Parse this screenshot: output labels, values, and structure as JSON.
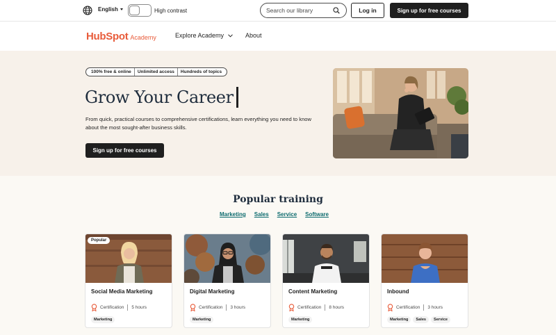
{
  "utility_bar": {
    "language": "English",
    "high_contrast_label": "High contrast",
    "search_placeholder": "Search our library",
    "login_label": "Log in",
    "signup_label": "Sign up for free courses"
  },
  "nav": {
    "logo_main": "HubSpot",
    "logo_sub": "Academy",
    "explore_label": "Explore Academy",
    "about_label": "About"
  },
  "hero": {
    "pills": [
      "100% free & online",
      "Unlimited access",
      "Hundreds of topics"
    ],
    "title": "Grow Your Career",
    "description": "From quick, practical courses to comprehensive certifications, learn everything you need to know about the most sought-after business skills.",
    "cta_label": "Sign up for free courses"
  },
  "popular": {
    "title": "Popular training",
    "tabs": [
      "Marketing",
      "Sales",
      "Service",
      "Software"
    ],
    "cards": [
      {
        "badge": "Popular",
        "title": "Social Media Marketing",
        "type": "Certification",
        "duration": "5 hours",
        "tags": [
          "Marketing"
        ]
      },
      {
        "title": "Digital Marketing",
        "type": "Certification",
        "duration": "3 hours",
        "tags": [
          "Marketing"
        ]
      },
      {
        "title": "Content Marketing",
        "type": "Certification",
        "duration": "8 hours",
        "tags": [
          "Marketing"
        ]
      },
      {
        "title": "Inbound",
        "type": "Certification",
        "duration": "3 hours",
        "tags": [
          "Marketing",
          "Sales",
          "Service"
        ]
      }
    ]
  },
  "colors": {
    "brand_orange": "#e85c3b",
    "link_teal": "#0c6b6e",
    "dark_button": "#1f1f1f",
    "hero_bg": "#f7f1ea"
  }
}
